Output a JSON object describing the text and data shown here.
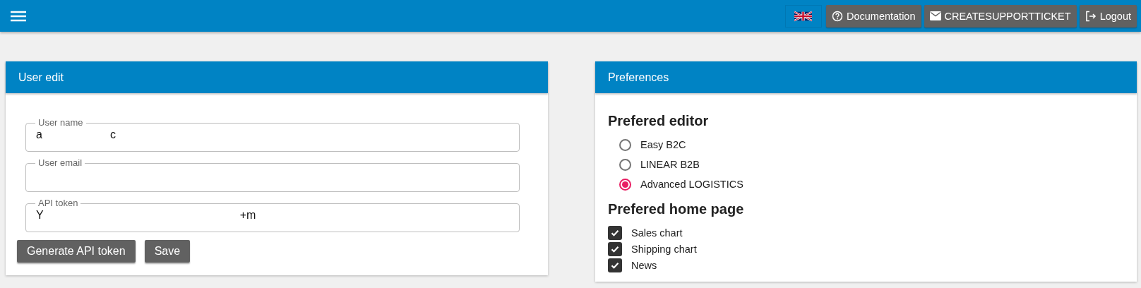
{
  "topbar": {
    "buttons": [
      {
        "kind": "flag"
      },
      {
        "kind": "help",
        "label": "Documentation"
      },
      {
        "kind": "mail",
        "label": "CREATESUPPORTTICKET"
      },
      {
        "kind": "logout",
        "label": "Logout"
      }
    ]
  },
  "user_edit": {
    "title": "User edit",
    "fields": [
      {
        "label": "User name",
        "value_parts": [
          "a",
          "c"
        ]
      },
      {
        "label": "User email"
      },
      {
        "label": "API token",
        "value_parts": [
          "Y",
          "+m"
        ]
      }
    ],
    "buttons": [
      "Generate API token",
      "Save"
    ]
  },
  "preferences": {
    "title": "Preferences",
    "editor_heading": "Prefered editor",
    "editors": [
      {
        "label": "Easy B2C",
        "selected": false
      },
      {
        "label": "LINEAR B2B",
        "selected": false
      },
      {
        "label": "Advanced LOGISTICS",
        "selected": true
      }
    ],
    "home_heading": "Prefered home page",
    "home_pages": [
      {
        "label": "Sales chart",
        "checked": true
      },
      {
        "label": "Shipping chart",
        "checked": true
      },
      {
        "label": "News",
        "checked": true
      }
    ]
  }
}
